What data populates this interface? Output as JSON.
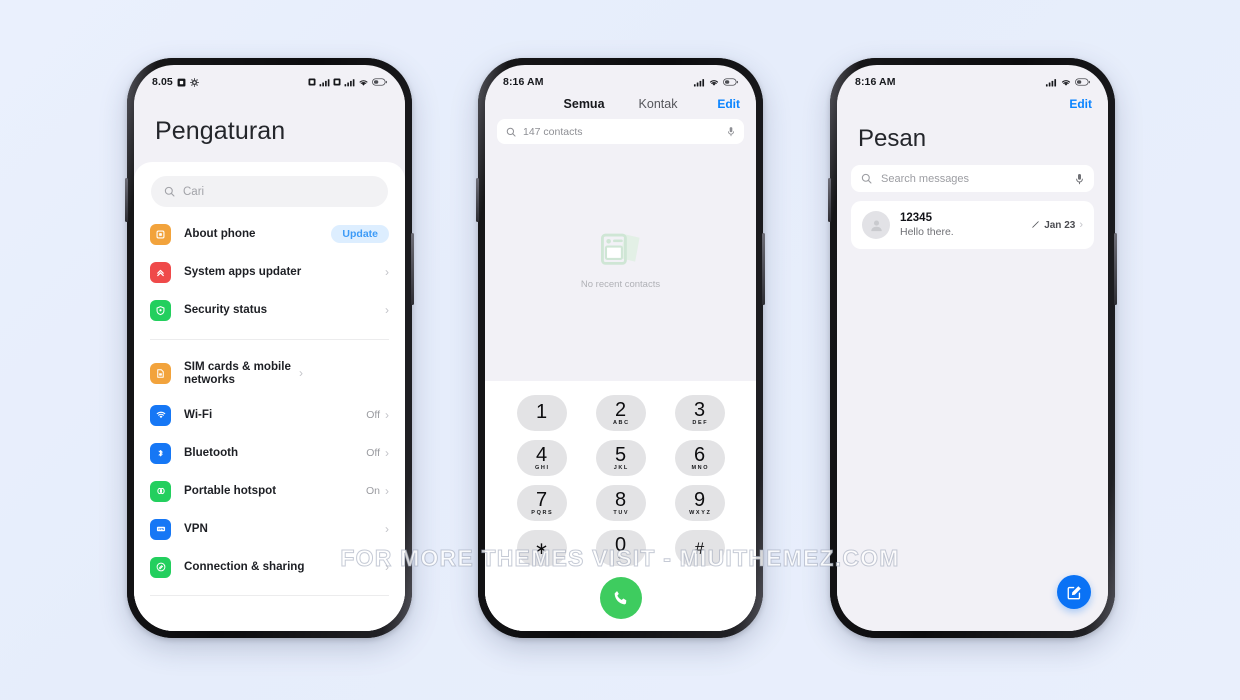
{
  "watermark": "FOR MORE THEMES VISIT - MIUITHEMEZ.COM",
  "colors": {
    "page_background": "#e8eefc",
    "accent_blue": "#0a84ff",
    "fab_blue": "#0a72f5",
    "call_green": "#3ecc5f",
    "badge_bg": "#ddeeff",
    "screen_bg": "#f2f1f6",
    "card_white": "#ffffff"
  },
  "settings_phone": {
    "statusbar": {
      "time": "8.05",
      "icons": [
        "alarm-icon",
        "gear-icon",
        "sim1-signal-icon",
        "sim2-signal-icon",
        "wifi-icon",
        "battery-icon"
      ]
    },
    "title": "Pengaturan",
    "search": {
      "placeholder": "Cari",
      "icon": "search-icon"
    },
    "groups": [
      {
        "rows": [
          {
            "label": "About phone",
            "icon": "about-phone-icon",
            "icon_color": "#f2a33c",
            "badge": "Update",
            "value": "",
            "chevron": false
          },
          {
            "label": "System apps updater",
            "icon": "system-apps-updater-icon",
            "icon_color": "#ef4a4a",
            "badge": "",
            "value": "",
            "chevron": true
          },
          {
            "label": "Security status",
            "icon": "security-status-icon",
            "icon_color": "#23cf5e",
            "badge": "",
            "value": "",
            "chevron": true
          }
        ]
      },
      {
        "rows": [
          {
            "label": "SIM cards & mobile networks",
            "icon": "sim-card-icon",
            "icon_color": "#f2a33c",
            "badge": "",
            "value": "",
            "chevron": true
          },
          {
            "label": "Wi-Fi",
            "icon": "wifi-icon",
            "icon_color": "#1677f5",
            "badge": "",
            "value": "Off",
            "chevron": true
          },
          {
            "label": "Bluetooth",
            "icon": "bluetooth-icon",
            "icon_color": "#1677f5",
            "badge": "",
            "value": "Off",
            "chevron": true
          },
          {
            "label": "Portable hotspot",
            "icon": "hotspot-icon",
            "icon_color": "#23cf5e",
            "badge": "",
            "value": "On",
            "chevron": true
          },
          {
            "label": "VPN",
            "icon": "vpn-icon",
            "icon_color": "#1677f5",
            "badge": "",
            "value": "",
            "chevron": true
          },
          {
            "label": "Connection & sharing",
            "icon": "connection-sharing-icon",
            "icon_color": "#23cf5e",
            "badge": "",
            "value": "",
            "chevron": true
          }
        ]
      }
    ]
  },
  "dialer_phone": {
    "statusbar": {
      "time": "8:16 AM",
      "icons": [
        "signal-icon",
        "wifi-icon",
        "battery-icon"
      ]
    },
    "tabs": [
      {
        "label": "Semua",
        "active": true
      },
      {
        "label": "Kontak",
        "active": false
      }
    ],
    "edit_label": "Edit",
    "search": {
      "placeholder": "147 contacts",
      "icon": "search-icon",
      "mic_icon": "microphone-icon"
    },
    "empty_state": {
      "label": "No recent contacts",
      "icon": "contact-card-icon"
    },
    "keypad": [
      {
        "digit": "1",
        "letters": ""
      },
      {
        "digit": "2",
        "letters": "ABC"
      },
      {
        "digit": "3",
        "letters": "DEF"
      },
      {
        "digit": "4",
        "letters": "GHI"
      },
      {
        "digit": "5",
        "letters": "JKL"
      },
      {
        "digit": "6",
        "letters": "MNO"
      },
      {
        "digit": "7",
        "letters": "PQRS"
      },
      {
        "digit": "8",
        "letters": "TUV"
      },
      {
        "digit": "9",
        "letters": "WXYZ"
      },
      {
        "digit": "∗",
        "letters": ""
      },
      {
        "digit": "0",
        "letters": "+"
      },
      {
        "digit": "#",
        "letters": ""
      }
    ],
    "call_button": {
      "icon": "phone-call-icon"
    }
  },
  "messages_phone": {
    "statusbar": {
      "time": "8:16 AM",
      "icons": [
        "signal-icon",
        "wifi-icon",
        "battery-icon"
      ]
    },
    "edit_label": "Edit",
    "title": "Pesan",
    "search": {
      "placeholder": "Search messages",
      "icon": "search-icon",
      "mic_icon": "microphone-icon"
    },
    "threads": [
      {
        "name": "12345",
        "preview": "Hello there.",
        "date": "Jan 23",
        "status_icon": "draft-pencil-icon",
        "avatar_icon": "person-avatar-icon"
      }
    ],
    "compose_button": {
      "icon": "compose-icon"
    }
  }
}
